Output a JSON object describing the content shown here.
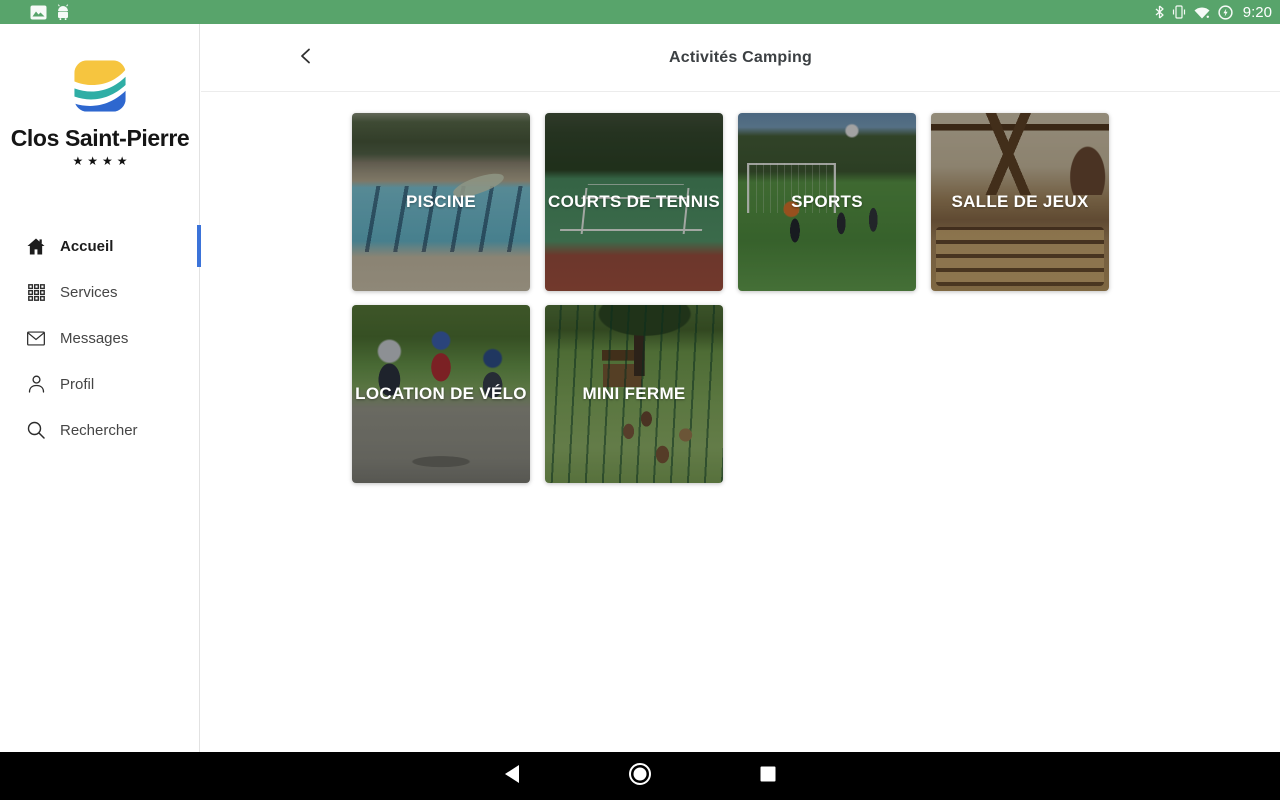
{
  "status_bar": {
    "time": "9:20",
    "left_icons": [
      "gallery-icon",
      "android-icon"
    ],
    "right_icons": [
      "bluetooth-icon",
      "vibrate-icon",
      "wifi-icon",
      "battery-charging-icon"
    ],
    "bg_color": "#58A46B"
  },
  "sidebar": {
    "logo_name": "Clos Saint-Pierre",
    "stars": "★★★★",
    "logo_colors": {
      "yellow": "#F6C53F",
      "teal": "#2FAEA5",
      "blue": "#2E67CF"
    },
    "active_color": "#3B73D9",
    "items": [
      {
        "label": "Accueil",
        "icon": "home-icon",
        "active": true
      },
      {
        "label": "Services",
        "icon": "grid-icon",
        "active": false
      },
      {
        "label": "Messages",
        "icon": "mail-icon",
        "active": false
      },
      {
        "label": "Profil",
        "icon": "person-icon",
        "active": false
      },
      {
        "label": "Rechercher",
        "icon": "search-icon",
        "active": false
      }
    ]
  },
  "header": {
    "title": "Activités Camping",
    "back_icon": "chevron-left-icon"
  },
  "activities": [
    {
      "label": "PISCINE"
    },
    {
      "label": "COURTS DE TENNIS"
    },
    {
      "label": "SPORTS"
    },
    {
      "label": "SALLE DE JEUX"
    },
    {
      "label": "LOCATION DE VÉLO"
    },
    {
      "label": "MINI FERME"
    }
  ],
  "nav_bar": {
    "icons": [
      "back-icon",
      "home-icon",
      "recents-icon"
    ],
    "bg_color": "#000000"
  }
}
